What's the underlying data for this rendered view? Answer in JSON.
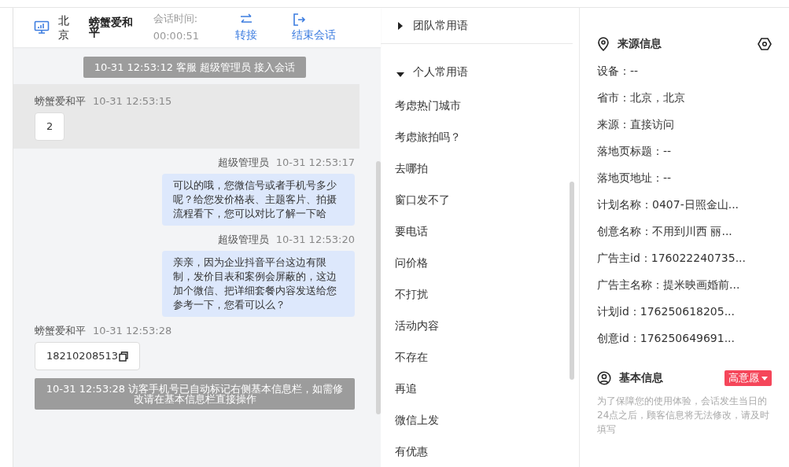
{
  "header": {
    "location": "北京",
    "visitor": "螃蟹爱和平",
    "duration_label": "会话时间:",
    "duration": "00:00:51",
    "actions": [
      {
        "label": "转接",
        "kind": "transfer"
      },
      {
        "label": "结束会话",
        "kind": "end"
      }
    ]
  },
  "messages": [
    {
      "kind": "system",
      "text": "10-31 12:53:12 客服 超级管理员 接入会话"
    },
    {
      "kind": "visitor",
      "sender": "螃蟹爱和平",
      "time": "10-31 12:53:15",
      "text": "2",
      "highlighted": true,
      "copyable": false
    },
    {
      "kind": "agent",
      "sender": "超级管理员",
      "time": "10-31 12:53:17",
      "text": "可以的哦，您微信号或者手机号多少呢？给您发价格表、主题客片、拍摄流程看下，您可以对比了解一下哈"
    },
    {
      "kind": "agent",
      "sender": "超级管理员",
      "time": "10-31 12:53:20",
      "text": "亲亲，因为企业抖音平台这边有限制，发价目表和案例会屏蔽的，这边加个微信、把详细套餐内容发送给您参考一下，您看可以么？"
    },
    {
      "kind": "visitor",
      "sender": "螃蟹爱和平",
      "time": "10-31 12:53:28",
      "text": "18210208513",
      "highlighted": false,
      "copyable": true
    },
    {
      "kind": "system",
      "text": "10-31 12:53:28 访客手机号已自动标记右侧基本信息栏，如需修改请在基本信息栏直接操作"
    }
  ],
  "phrases": {
    "groups": [
      {
        "title": "团队常用语",
        "expanded": false
      },
      {
        "title": "个人常用语",
        "expanded": true,
        "items": [
          "考虑热门城市",
          "考虑旅拍吗？",
          "去哪拍",
          "窗口发不了",
          "要电话",
          "问价格",
          "不打扰",
          "活动内容",
          "不存在",
          "再追",
          "微信上发",
          "有优惠"
        ]
      }
    ]
  },
  "source_info": {
    "title": "来源信息",
    "fields": [
      "设备：--",
      "省市：北京，北京",
      "来源：直接访问",
      "落地页标题：--",
      "落地页地址：--",
      "计划名称：0407-日照金山...",
      "创意名称：不用到川西 丽...",
      "广告主id：176022240735...",
      "广告主名称：提米映画婚前...",
      "计划id：176250618205...",
      "创意id：176250649691..."
    ]
  },
  "basic_info": {
    "title": "基本信息",
    "intent": {
      "label": "高意愿",
      "color": "#f5465a"
    },
    "notice": "为了保障您的使用体验，会话发生当日的24点之后，顾客信息将无法修改，请及时填写"
  }
}
